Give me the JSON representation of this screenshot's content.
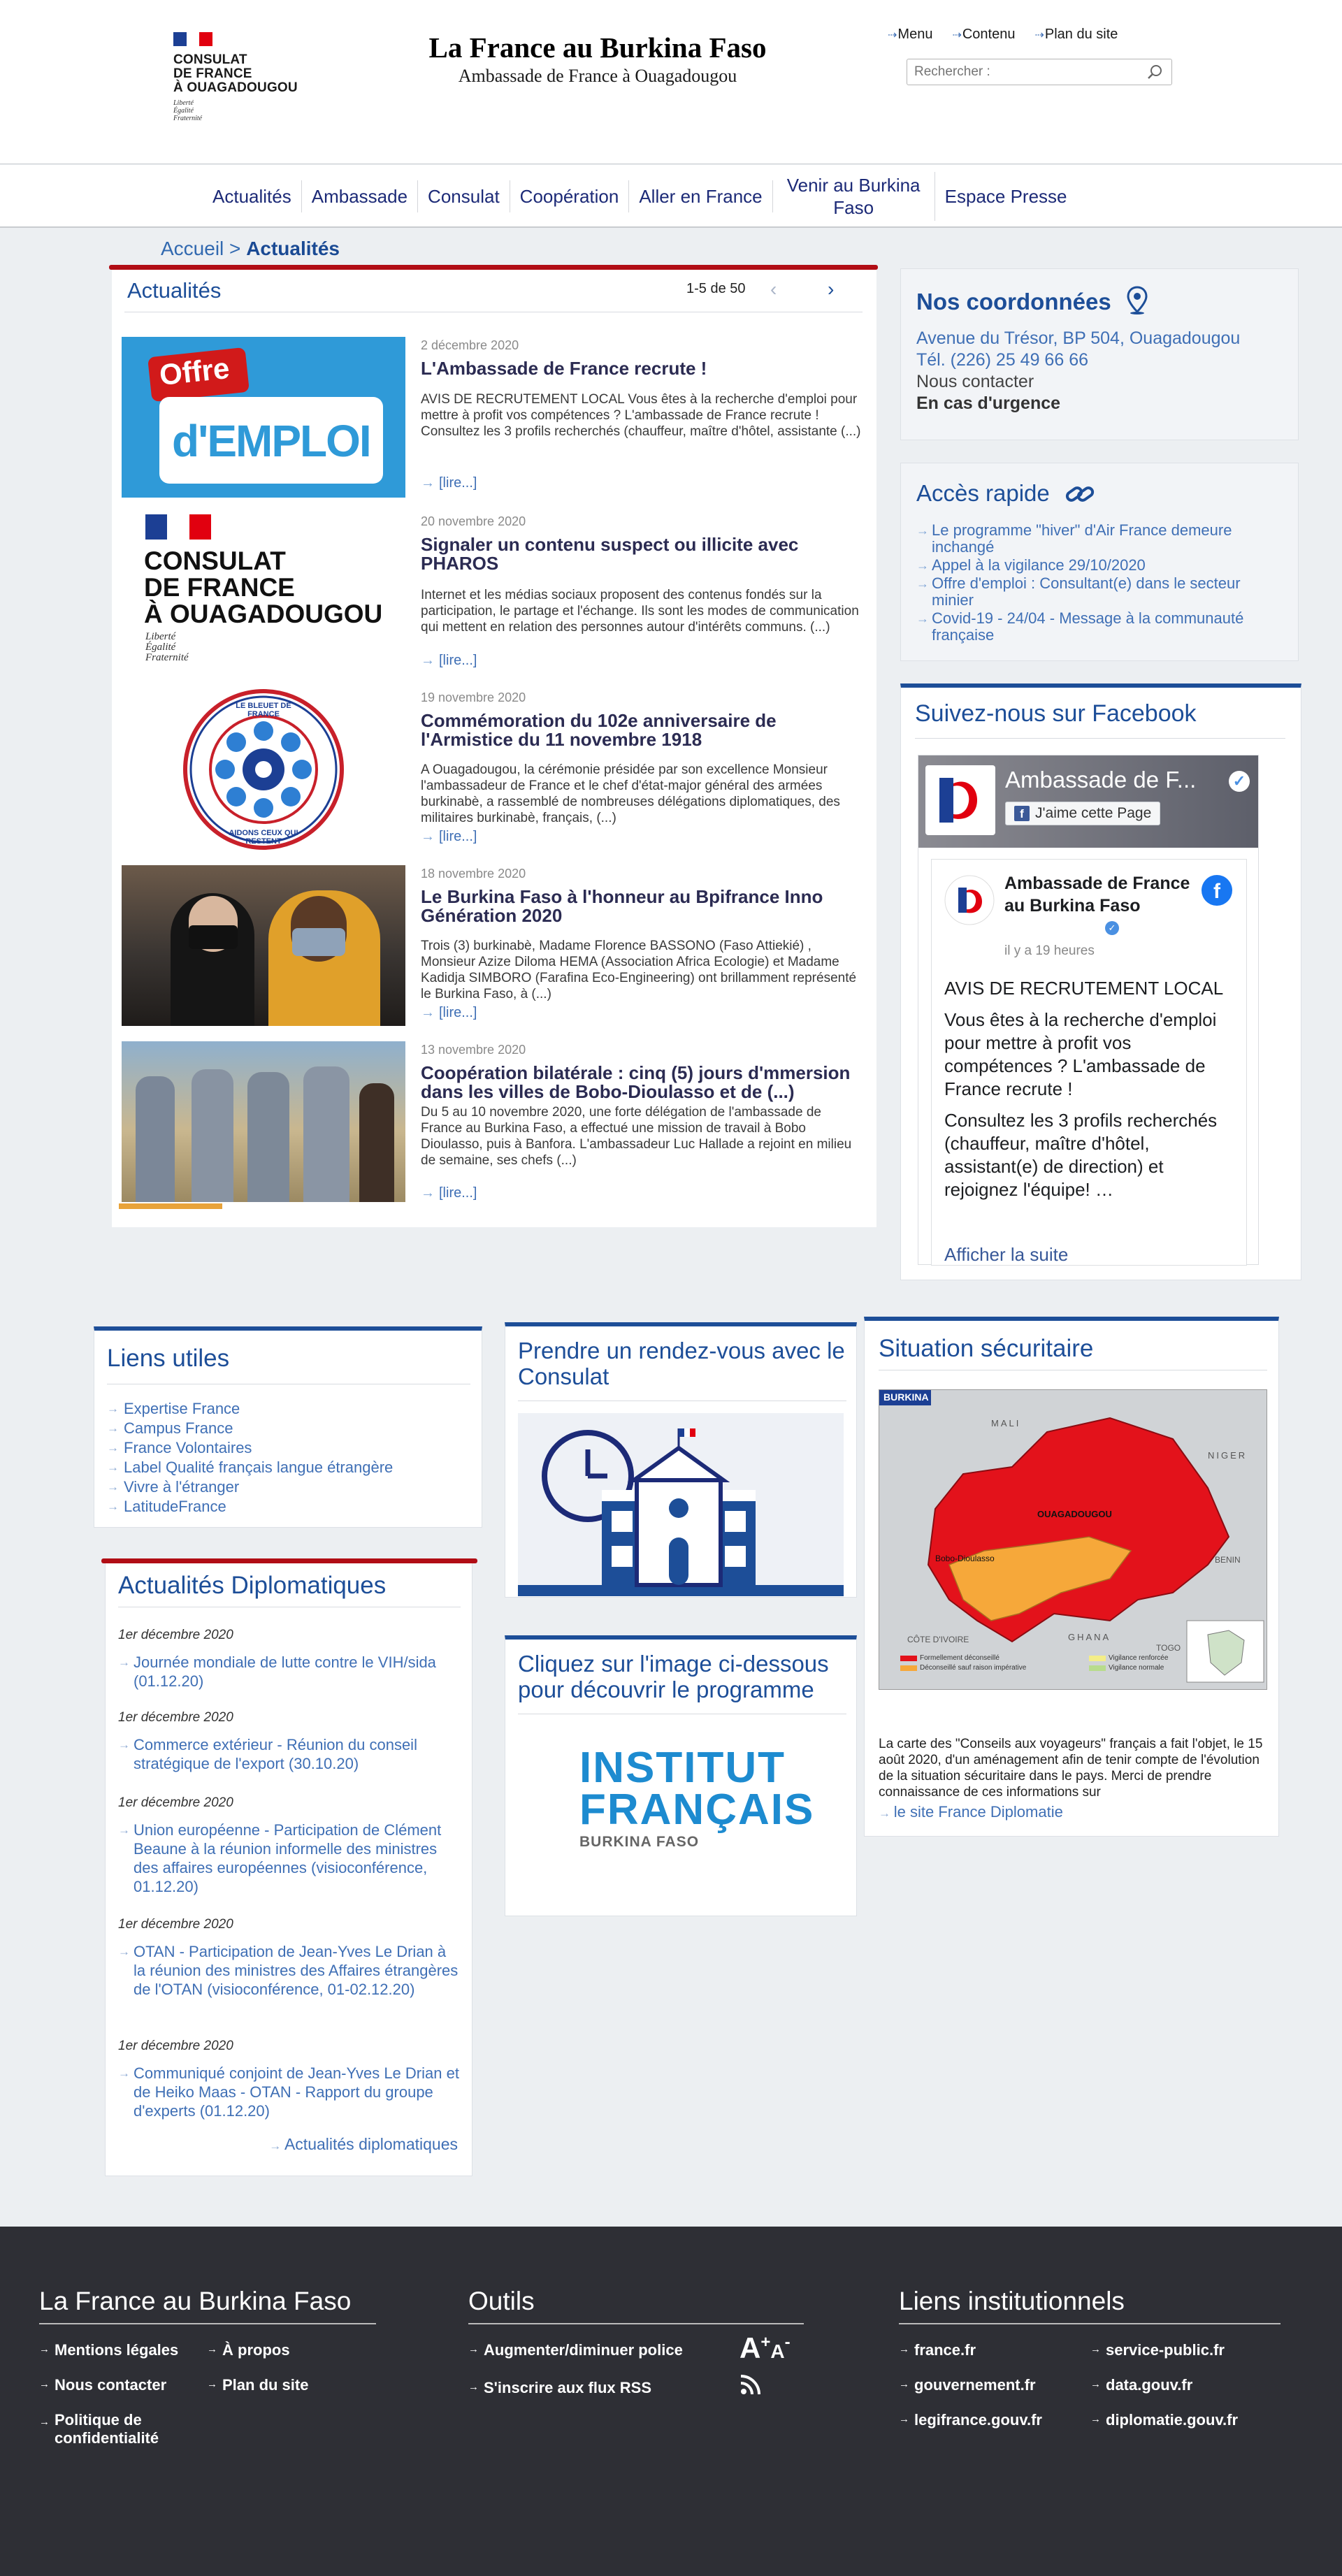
{
  "header": {
    "logo_lines": [
      "CONSULAT",
      "DE FRANCE",
      "À OUAGADOUGOU"
    ],
    "logo_motto": [
      "Liberté",
      "Égalité",
      "Fraternité"
    ],
    "site_title": "La France au Burkina Faso",
    "site_subtitle": "Ambassade de France à Ouagadougou",
    "top_links": [
      "Menu",
      "Contenu",
      "Plan du site"
    ],
    "search_placeholder": "Rechercher :"
  },
  "nav": [
    "Actualités",
    "Ambassade",
    "Consulat",
    "Coopération",
    "Aller en France",
    "Venir au Burkina Faso",
    "Espace Presse"
  ],
  "breadcrumb": {
    "home": "Accueil",
    "separator": ">",
    "current": "Actualités"
  },
  "news": {
    "title": "Actualités",
    "count": "1-5 de 50",
    "articles": [
      {
        "date": "2 décembre 2020",
        "title": "L'Ambassade de France recrute !",
        "body": "AVIS DE RECRUTEMENT LOCAL Vous êtes à la recherche d'emploi pour mettre à profit vos compétences ? L'ambassade de France recrute ! Consultez les 3 profils recherchés (chauffeur, maître d'hôtel, assistante (...)",
        "more": "[lire...]",
        "thumb": {
          "line1": "Offre",
          "line2": "d'EMPLOI"
        }
      },
      {
        "date": "20 novembre 2020",
        "title": "Signaler un contenu suspect ou illicite avec PHAROS",
        "body": "Internet et les médias sociaux proposent des contenus fondés sur la participation, le partage et l'échange. Ils sont les modes de communication qui mettent en relation des personnes autour d'intérêts communs. (...)",
        "more": "[lire...]",
        "thumb": {
          "lines": [
            "CONSULAT",
            "DE FRANCE",
            "À OUAGADOUGOU"
          ],
          "motto": [
            "Liberté",
            "Égalité",
            "Fraternité"
          ]
        }
      },
      {
        "date": "19 novembre 2020",
        "title": "Commémoration du 102e anniversaire de l'Armistice du 11 novembre 1918",
        "body": "A Ouagadougou, la cérémonie présidée par son excellence Monsieur l'ambassadeur de France et le chef d'état-major général des armées burkinabè, a rassemblé de nombreuses délégations diplomatiques, des militaires burkinabè, français, (...)",
        "more": "[lire...]",
        "thumb": {
          "top": "LE BLEUET DE FRANCE",
          "bottom": "AIDONS CEUX QUI RESTENT"
        }
      },
      {
        "date": "18 novembre 2020",
        "title": "Le Burkina Faso à l'honneur au Bpifrance Inno Génération 2020",
        "body": "Trois (3) burkinabè, Madame Florence BASSONO (Faso Attiekié) , Monsieur Azize Diloma HEMA (Association Africa Ecologie) et Madame Kadidja SIMBORO (Farafina Eco-Engineering) ont brillamment représenté le Burkina Faso, à (...)",
        "more": "[lire...]"
      },
      {
        "date": "13 novembre 2020",
        "title": "Coopération bilatérale : cinq (5) jours d'mmersion dans les villes de Bobo-Dioulasso et de (...)",
        "body": "Du 5 au 10 novembre 2020, une forte délégation de l'ambassade de France au Burkina Faso, a effectué une mission de travail à Bobo Dioulasso, puis à Banfora. L'ambassadeur Luc Hallade a rejoint en milieu de semaine, ses chefs (...)",
        "more": "[lire...]"
      }
    ]
  },
  "coords": {
    "title": "Nos coordonnées",
    "address": "Avenue du Trésor, BP 504, Ouagadougou",
    "phone": "Tél. (226) 25 49 66 66",
    "contact": "Nous contacter",
    "urgence": "En cas d'urgence"
  },
  "acces": {
    "title": "Accès rapide",
    "items": [
      "Le programme \"hiver\" d'Air France demeure inchangé",
      "Appel à la vigilance 29/10/2020",
      "Offre d'emploi : Consultant(e) dans le secteur minier",
      "Covid-19 - 24/04 - Message à la communauté française"
    ]
  },
  "facebook": {
    "title": "Suivez-nous sur Facebook",
    "page_name_short": "Ambassade de F...",
    "like_label": "J'aime cette Page",
    "page_name": "Ambassade de France au Burkina Faso",
    "time": "il y a 19 heures",
    "para1": "AVIS DE RECRUTEMENT LOCAL",
    "para2": "Vous êtes à la recherche d'emploi pour mettre à profit vos compétences ? L'ambassade de France recrute !",
    "para3": "Consultez les 3 profils recherchés (chauffeur, maître d'hôtel, assistant(e) de direction) et rejoignez l'équipe! …",
    "see_more": "Afficher la suite"
  },
  "liens_utiles": {
    "title": "Liens utiles",
    "items": [
      "Expertise France",
      "Campus France",
      "France Volontaires",
      "Label Qualité français langue étrangère",
      "Vivre à l'étranger",
      "LatitudeFrance"
    ]
  },
  "rdv": {
    "title": "Prendre un rendez-vous avec le Consulat"
  },
  "situation": {
    "title": "Situation sécuritaire",
    "map_label": "BURKINA",
    "map_places": [
      "MALI",
      "NIGER",
      "OUAGADOUGOU",
      "GHANA",
      "BENIN",
      "TOGO",
      "CÔTE D'IVOIRE",
      "Bobo-Dioulasso"
    ],
    "legend": [
      "Formellement déconseillé",
      "Déconseillé sauf raison impérative",
      "Vigilance renforcée",
      "Vigilance normale"
    ],
    "text": "La carte des \"Conseils aux voyageurs\" français a fait l'objet, le 15 août 2020, d'un aménagement afin de tenir compte de l'évolution de la situation sécuritaire dans le pays. Merci de prendre connaissance de ces informations sur",
    "link": "le site France Diplomatie"
  },
  "diplo": {
    "title": "Actualités Diplomatiques",
    "groups": [
      {
        "date": "1er décembre 2020",
        "link": "Journée mondiale de lutte contre le VIH/sida (01.12.20)"
      },
      {
        "date": "1er décembre 2020",
        "link": "Commerce extérieur - Réunion du conseil stratégique de l'export (30.10.20)"
      },
      {
        "date": "1er décembre 2020",
        "link": "Union européenne - Participation de Clément Beaune à la réunion informelle des ministres des affaires européennes (visioconférence, 01.12.20)"
      },
      {
        "date": "1er décembre 2020",
        "link": "OTAN - Participation de Jean-Yves Le Drian à la réunion des ministres des Affaires étrangères de l'OTAN (visioconférence, 01-02.12.20)"
      },
      {
        "date": "1er décembre 2020",
        "link": "Communiqué conjoint de Jean-Yves Le Drian et de Heiko Maas - OTAN - Rapport du groupe d'experts (01.12.20)"
      }
    ],
    "all_link": "Actualités diplomatiques"
  },
  "institut": {
    "title": "Cliquez sur l'image ci-dessous pour découvrir le programme",
    "logo_l1": "INSTITUT",
    "logo_l2": "FRANÇAIS",
    "logo_l3": "BURKINA FASO"
  },
  "footer": {
    "col1": {
      "title": "La France au Burkina Faso",
      "links": [
        "Mentions légales",
        "À propos",
        "Nous contacter",
        "Plan du site",
        "Politique de confidentialité"
      ]
    },
    "col2": {
      "title": "Outils",
      "links": [
        "Augmenter/diminuer police",
        "S'inscrire aux flux RSS"
      ],
      "font_icon": "A",
      "font_plus": "+",
      "font_small": "A",
      "font_minus": "-"
    },
    "col3": {
      "title": "Liens institutionnels",
      "links": [
        "france.fr",
        "service-public.fr",
        "gouvernement.fr",
        "data.gouv.fr",
        "legifrance.gouv.fr",
        "diplomatie.gouv.fr"
      ]
    }
  },
  "colors": {
    "blue": "#1d4e98",
    "red": "#b10d15",
    "link": "#3f6fb5",
    "footer": "#2e2f35"
  }
}
